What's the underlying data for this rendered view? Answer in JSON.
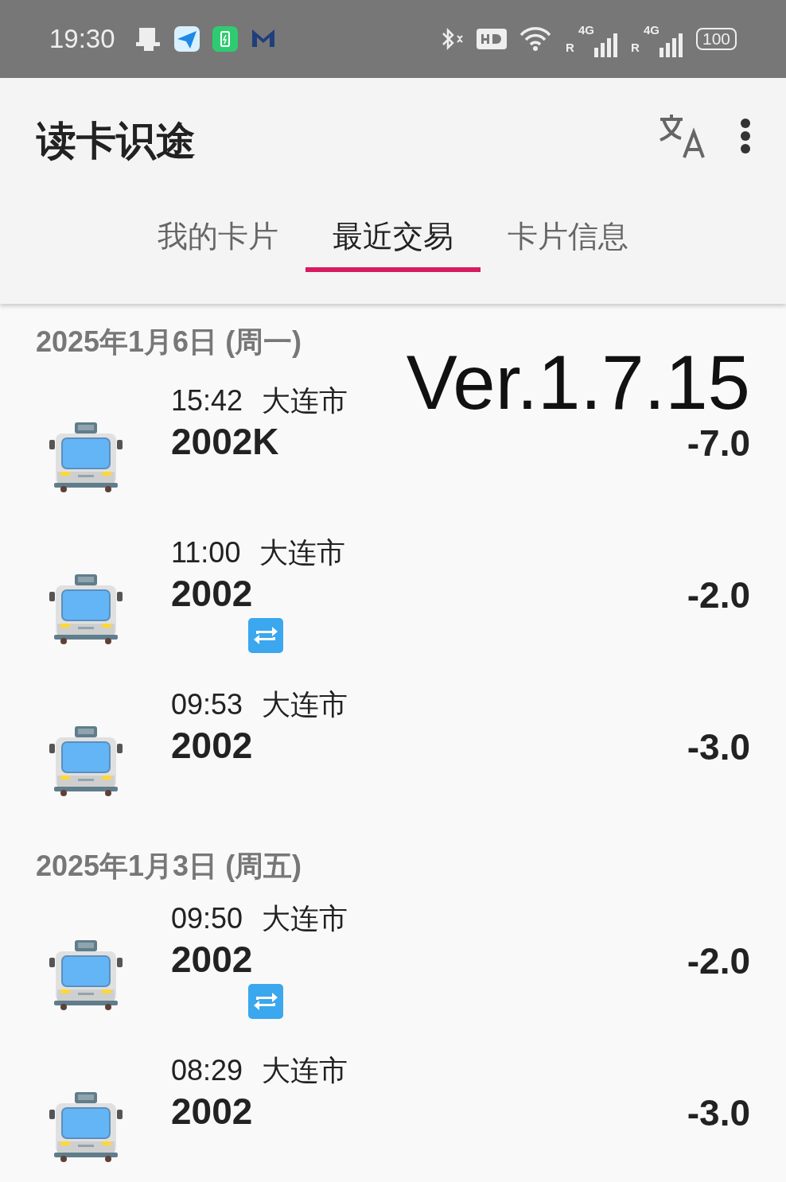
{
  "status_bar": {
    "time": "19:30",
    "battery": "100",
    "network_labels": [
      "4G",
      "R",
      "4G",
      "R"
    ]
  },
  "app_bar": {
    "title": "读卡识途"
  },
  "tabs": [
    {
      "label": "我的卡片",
      "selected": false
    },
    {
      "label": "最近交易",
      "selected": true
    },
    {
      "label": "卡片信息",
      "selected": false
    }
  ],
  "version": "Ver.1.7.15",
  "days": [
    {
      "date": "2025年1月6日 (周一)",
      "transactions": [
        {
          "kind": "bus",
          "time": "15:42",
          "city": "大连市",
          "route": "2002K",
          "amount": "-7.0",
          "transfer": false
        },
        {
          "kind": "bus",
          "time": "11:00",
          "city": "大连市",
          "route": "2002",
          "amount": "-2.0",
          "transfer": true
        },
        {
          "kind": "bus",
          "time": "09:53",
          "city": "大连市",
          "route": "2002",
          "amount": "-3.0",
          "transfer": false
        }
      ]
    },
    {
      "date": "2025年1月3日 (周五)",
      "transactions": [
        {
          "kind": "bus",
          "time": "09:50",
          "city": "大连市",
          "route": "2002",
          "amount": "-2.0",
          "transfer": true
        },
        {
          "kind": "bus",
          "time": "08:29",
          "city": "大连市",
          "route": "2002",
          "amount": "-3.0",
          "transfer": false
        }
      ]
    }
  ]
}
